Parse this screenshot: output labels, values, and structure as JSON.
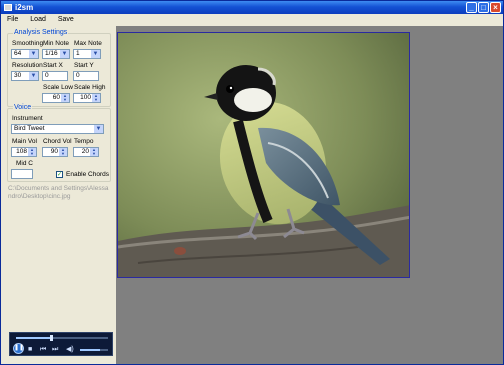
{
  "window": {
    "title": "i2sm"
  },
  "menu": [
    "File",
    "Load",
    "Save"
  ],
  "analysis": {
    "title": "Analysis Settings",
    "smoothing": {
      "label": "Smoothing",
      "value": "64"
    },
    "min_note": {
      "label": "Min Note",
      "value": "1/16"
    },
    "max_note": {
      "label": "Max Note",
      "value": "1"
    },
    "resolution": {
      "label": "Resolution",
      "value": "30"
    },
    "start_x": {
      "label": "Start X",
      "value": "0"
    },
    "start_y": {
      "label": "Start Y",
      "value": "0"
    },
    "scale_low": {
      "label": "Scale Low",
      "value": "60"
    },
    "scale_high": {
      "label": "Scale High",
      "value": "100"
    }
  },
  "voice": {
    "title": "Voice",
    "instrument": {
      "label": "Instrument",
      "value": "Bird Tweet"
    },
    "main_vol": {
      "label": "Main Vol",
      "value": "108"
    },
    "chord_vol": {
      "label": "Chord Vol",
      "value": "90"
    },
    "tempo": {
      "label": "Tempo",
      "value": "20"
    },
    "mid_c": {
      "label": "Mid C",
      "value": ""
    },
    "enable_chords": {
      "label": "Enable Chords",
      "checked": true
    }
  },
  "file_path": "C:\\Documents and Settings\\Alessandro\\Desktop\\cinc.jpg",
  "player": {
    "seek_progress": 0.38,
    "volume": 0.7
  },
  "colors": {
    "accent": "#0046d5",
    "canvas": "#808080"
  }
}
